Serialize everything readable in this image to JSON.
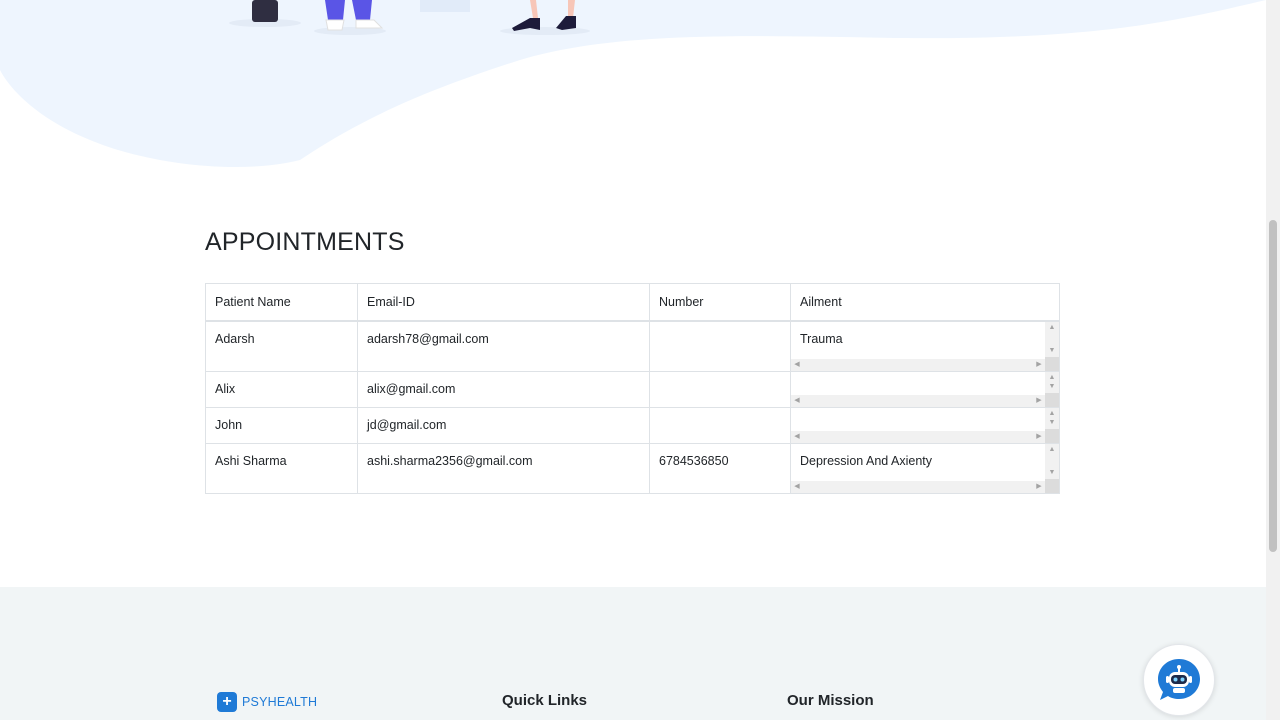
{
  "appointments": {
    "title": "APPOINTMENTS",
    "columns": [
      "Patient Name",
      "Email-ID",
      "Number",
      "Ailment"
    ],
    "rows": [
      {
        "name": "Adarsh",
        "email": "adarsh78@gmail.com",
        "number": "",
        "ailment": "Trauma"
      },
      {
        "name": "Alix",
        "email": "alix@gmail.com",
        "number": "",
        "ailment": ""
      },
      {
        "name": "John",
        "email": "jd@gmail.com",
        "number": "",
        "ailment": ""
      },
      {
        "name": "Ashi Sharma",
        "email": "ashi.sharma2356@gmail.com",
        "number": "6784536850",
        "ailment": "Depression And Axienty"
      }
    ]
  },
  "footer": {
    "brand": "PSYHEALTH",
    "quick_links_title": "Quick Links",
    "mission_title": "Our Mission"
  },
  "colors": {
    "brand_blue": "#1f7ad6",
    "hero_wave": "#eef5fe",
    "footer_bg": "#f1f5f6"
  },
  "icons": {
    "chatbot": "robot-chat-icon",
    "logo": "medical-cross-icon"
  }
}
